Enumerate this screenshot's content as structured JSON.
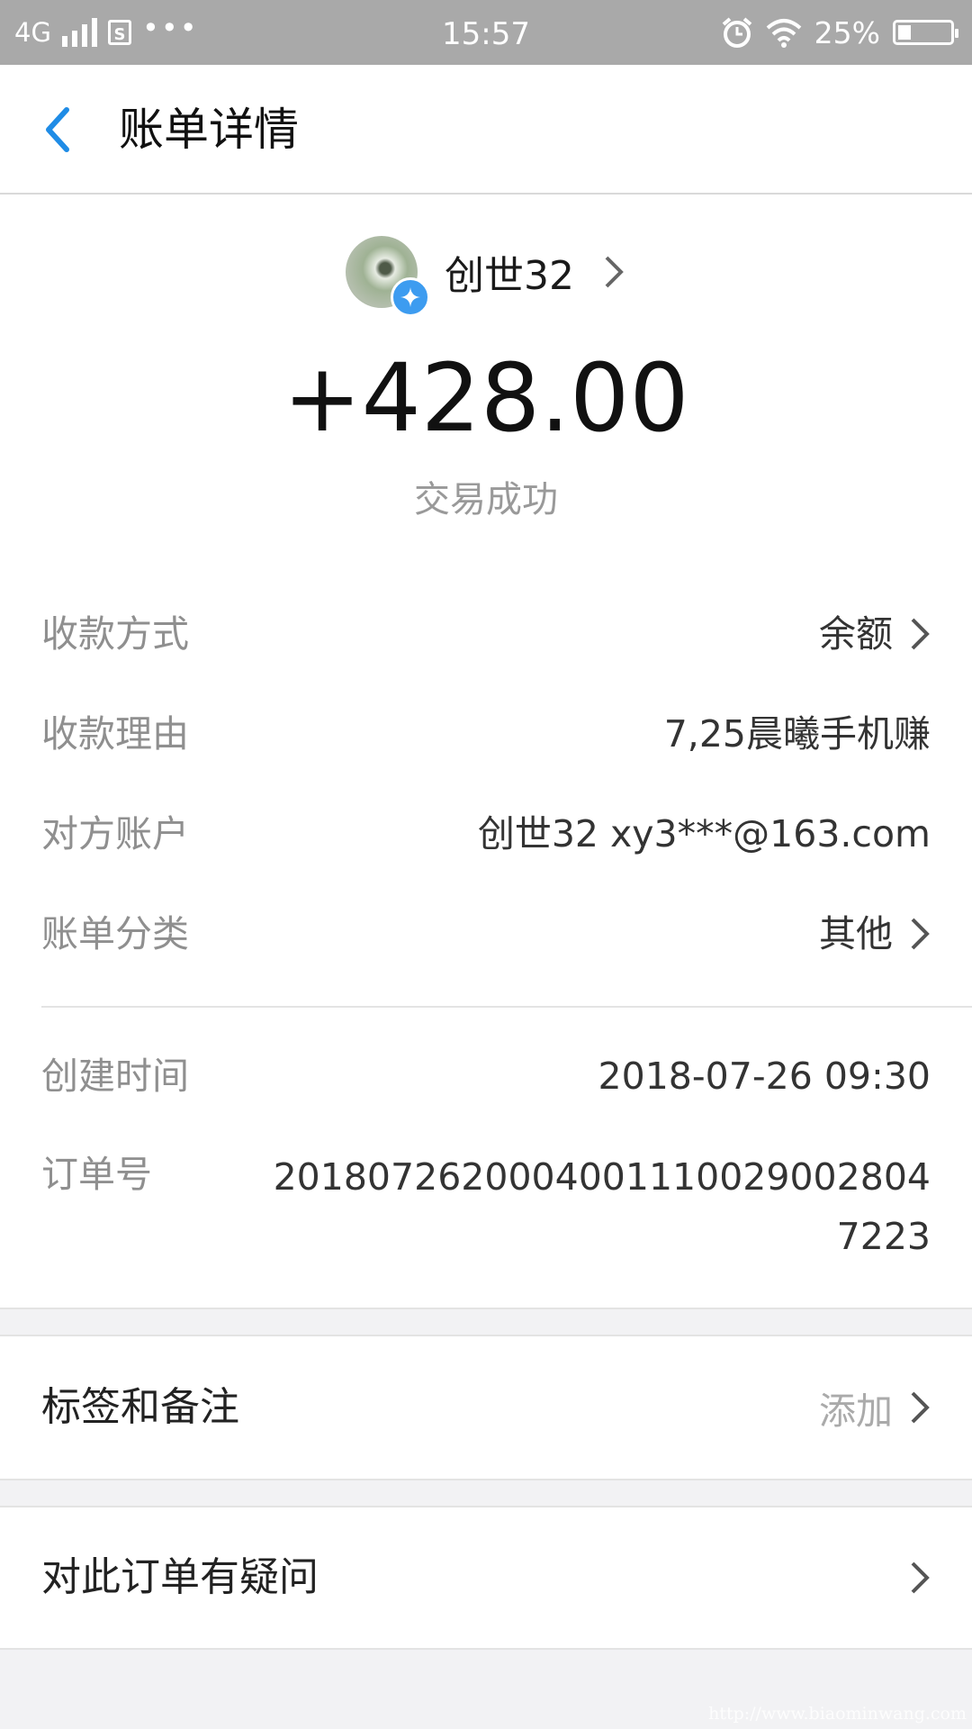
{
  "status_bar": {
    "network": "4G",
    "time": "15:57",
    "battery_percent": "25%",
    "battery_level": 0.25,
    "icons": [
      "signal-icon",
      "sim-icon",
      "more-icon",
      "alarm-icon",
      "wifi-icon",
      "battery-icon"
    ]
  },
  "nav": {
    "title": "账单详情",
    "back_icon": "back-arrow-icon"
  },
  "payer": {
    "name": "创世32"
  },
  "amount": "+428.00",
  "status": "交易成功",
  "details": [
    {
      "label": "收款方式",
      "value": "余额"
    },
    {
      "label": "收款理由",
      "value": "7,25晨曦手机赚"
    },
    {
      "label": "对方账户",
      "value": "创世32 xy3***@163.com"
    },
    {
      "label": "账单分类",
      "value": "其他"
    }
  ],
  "time_row": {
    "label": "创建时间",
    "value": "2018-07-26 09:30"
  },
  "order_row": {
    "label": "订单号",
    "value": "2018072620004001110029002804​7223"
  },
  "tags": {
    "label": "标签和备注",
    "action": "添加"
  },
  "question": {
    "label": "对此订单有疑问"
  },
  "watermark": "http://www.biaominwang.com",
  "colors": {
    "accent": "#3d9cf0",
    "status_bar": "#a9a9a9",
    "background": "#f2f2f4"
  }
}
